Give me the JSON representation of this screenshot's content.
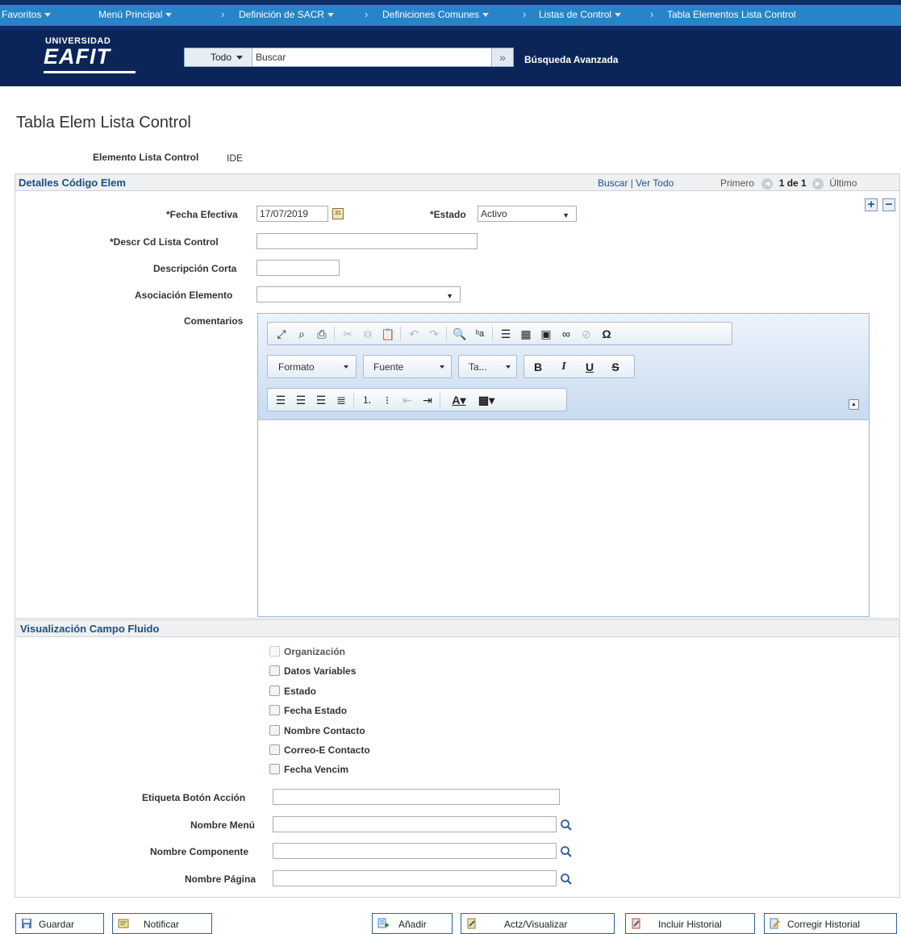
{
  "nav": {
    "favorites": "Favoritos",
    "main_menu": "Menú Principal",
    "crumbs": [
      "Definición de SACR",
      "Definiciones Comunes",
      "Listas de Control",
      "Tabla Elementos Lista Control"
    ]
  },
  "banner": {
    "logo_top": "UNIVERSIDAD",
    "logo_main": "EAFIT",
    "search_scope": "Todo",
    "search_placeholder": "Buscar",
    "advanced_search": "Búsqueda Avanzada"
  },
  "page": {
    "title": "Tabla Elem Lista Control",
    "element_label": "Elemento Lista Control",
    "element_value": "IDE"
  },
  "details": {
    "title": "Detalles Código Elem",
    "search_link": "Buscar",
    "separator": "|",
    "view_all_link": "Ver Todo",
    "first": "Primero",
    "counter": "1 de 1",
    "last": "Último",
    "effective_date_label": "*Fecha Efectiva",
    "effective_date_value": "17/07/2019",
    "status_label": "*Estado",
    "status_value": "Activo",
    "descr_label": "*Descr Cd Lista Control",
    "descr_value": "",
    "short_descr_label": "Descripción Corta",
    "short_descr_value": "",
    "assoc_label": "Asociación Elemento",
    "assoc_value": "",
    "comments_label": "Comentarios"
  },
  "editor": {
    "format_label": "Formato",
    "font_label": "Fuente",
    "size_label": "Ta..."
  },
  "fluid": {
    "title": "Visualización Campo Fluido",
    "checkboxes": [
      {
        "label": "Organización",
        "checked": false,
        "disabled": true
      },
      {
        "label": "Datos Variables",
        "checked": false,
        "disabled": false
      },
      {
        "label": "Estado",
        "checked": false,
        "disabled": false
      },
      {
        "label": "Fecha Estado",
        "checked": false,
        "disabled": false
      },
      {
        "label": "Nombre Contacto",
        "checked": false,
        "disabled": false
      },
      {
        "label": "Correo-E Contacto",
        "checked": false,
        "disabled": false
      },
      {
        "label": "Fecha Vencim",
        "checked": false,
        "disabled": false
      }
    ],
    "action_label": "Etiqueta Botón Acción",
    "menu_label": "Nombre Menú",
    "component_label": "Nombre Componente",
    "page_label": "Nombre Página"
  },
  "buttons": {
    "save": "Guardar",
    "notify": "Notificar",
    "add": "Añadir",
    "update": "Actz/Visualizar",
    "include_history": "Incluir Historial",
    "correct_history": "Corregir Historial"
  },
  "colors": {
    "nav_bar": "#2784c8",
    "banner": "#0b2559",
    "section_title": "#1f4e80",
    "link": "#1f4e9c"
  }
}
